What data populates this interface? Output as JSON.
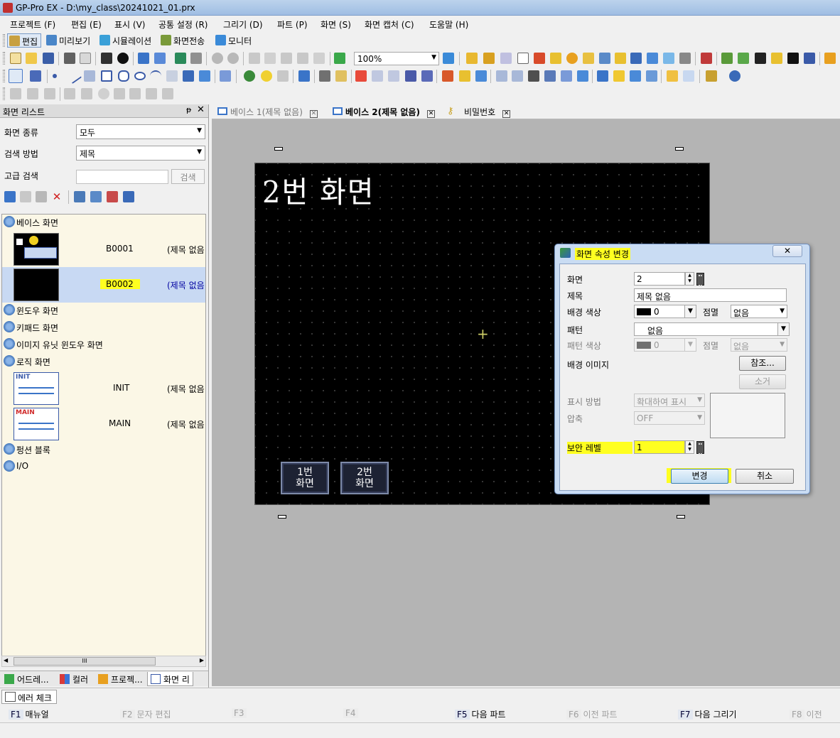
{
  "window": {
    "title": "GP-Pro EX - D:\\my_class\\20241021_01.prx"
  },
  "menu": [
    "프로젝트 (F)",
    "편집 (E)",
    "표시 (V)",
    "공통 설정 (R)",
    "그리기 (D)",
    "파트 (P)",
    "화면 (S)",
    "화면 캡처 (C)",
    "도움말 (H)"
  ],
  "modes": [
    "편집",
    "미리보기",
    "시뮬레이션",
    "화면전송",
    "모니터"
  ],
  "toolbar": {
    "zoom": "100%"
  },
  "left_panel": {
    "title": "화면 리스트",
    "screen_type_label": "화면 종류",
    "screen_type_value": "모두",
    "search_method_label": "검색 방법",
    "search_method_value": "제목",
    "advanced_search_label": "고급 검색",
    "search_button": "검색",
    "tree": {
      "base": "베이스 화면",
      "window": "윈도우 화면",
      "keypad": "키패드 화면",
      "image_unit": "이미지 유닛 윈도우 화면",
      "logic": "로직 화면",
      "function_block": "펑션 블록",
      "io": "I/O"
    },
    "base_rows": [
      {
        "id": "B0001",
        "title": "(제목 없음"
      },
      {
        "id": "B0002",
        "title": "(제목 없음"
      }
    ],
    "logic_rows": [
      {
        "id": "INIT",
        "title": "(제목 없음",
        "thumb": "INIT"
      },
      {
        "id": "MAIN",
        "title": "(제목 없음",
        "thumb": "MAIN"
      }
    ],
    "scroll_grip": "III",
    "tabs": [
      "어드레...",
      "컬러",
      "프로젝...",
      "화면 리"
    ]
  },
  "doc_tabs": [
    {
      "label": "베이스 1(제목 없음)"
    },
    {
      "label": "베이스 2(제목 없음)"
    },
    {
      "label": "비밀번호"
    }
  ],
  "screen": {
    "title": "2번 화면",
    "button1": "1번\n화면",
    "button2": "2번\n화면"
  },
  "dialog": {
    "title": "화면 속성 변경",
    "screen_label": "화면",
    "screen_value": "2",
    "title_label": "제목",
    "title_value": "제목 없음",
    "bg_color_label": "배경 색상",
    "bg_color_value": "0",
    "blink_label": "점멸",
    "blink_value": "없음",
    "pattern_label": "패턴",
    "pattern_value": "없음",
    "pattern_color_label": "패턴 색상",
    "pattern_color_value": "0",
    "blink2_label": "점멸",
    "blink2_value": "없음",
    "bg_image_label": "배경 이미지",
    "browse_button": "참조...",
    "clear_button": "소거",
    "display_method_label": "표시 방법",
    "display_method_value": "확대하여 표시",
    "compression_label": "압축",
    "compression_value": "OFF",
    "security_label": "보안 레벨",
    "security_value": "1",
    "ok_button": "변경",
    "cancel_button": "취소"
  },
  "error_check": "에러 체크",
  "function_keys": [
    {
      "key": "F1",
      "label": "매뉴얼",
      "enabled": true
    },
    {
      "key": "F2",
      "label": "문자 편집",
      "enabled": false
    },
    {
      "key": "F3",
      "label": "",
      "enabled": false
    },
    {
      "key": "F4",
      "label": "",
      "enabled": false
    },
    {
      "key": "F5",
      "label": "다음 파트",
      "enabled": true
    },
    {
      "key": "F6",
      "label": "이전 파트",
      "enabled": false
    },
    {
      "key": "F7",
      "label": "다음 그리기",
      "enabled": true
    },
    {
      "key": "F8",
      "label": "이전",
      "enabled": false
    }
  ],
  "colors": {
    "highlight": "#ffff20",
    "canvas_bg": "#000000",
    "workspace_bg": "#b4b4b4",
    "dialog_frame": "#c9dcf3"
  }
}
